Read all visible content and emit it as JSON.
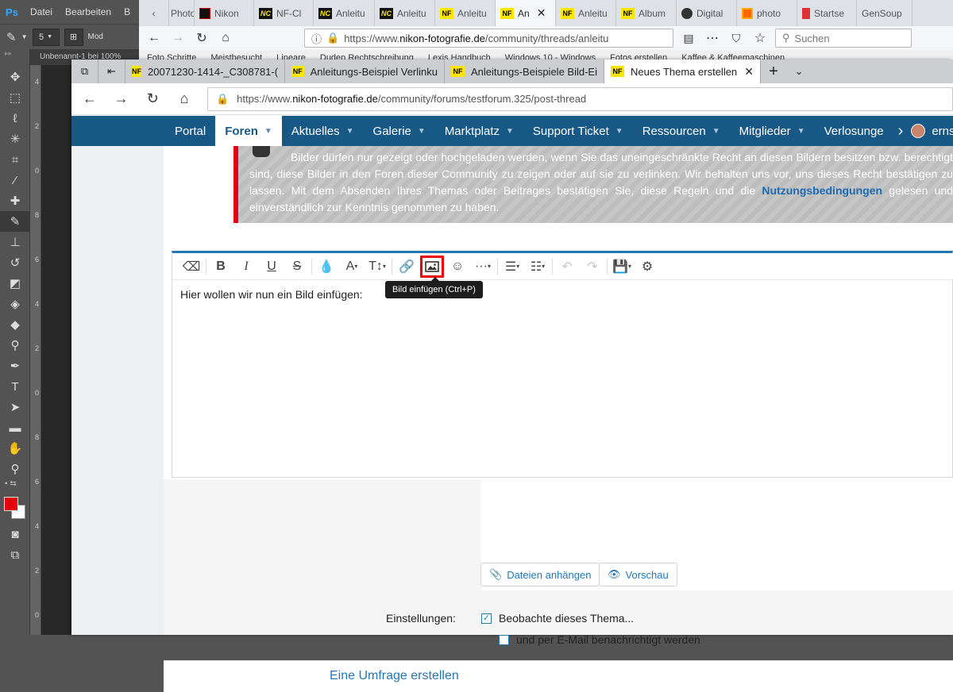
{
  "photoshop": {
    "logo": "Ps",
    "menu": [
      "Datei",
      "Bearbeiten",
      "B"
    ],
    "brush_size": "5",
    "mode_label": "Mod",
    "doc_tab": "Unbenannt-1 bei 100%",
    "ruler_numbers": [
      "4",
      "2",
      "0",
      "8",
      "6",
      "4",
      "2",
      "0",
      "8",
      "6",
      "4",
      "2",
      "0"
    ],
    "foreground_color": "#e3000f",
    "background_color": "#ffffff"
  },
  "back_browser": {
    "tabs": [
      {
        "label": "Photo",
        "favicon": "chevron-left"
      },
      {
        "label": "Nikon",
        "favicon": "nk"
      },
      {
        "label": "NF-Cl",
        "favicon": "nc"
      },
      {
        "label": "Anleitu",
        "favicon": "nc"
      },
      {
        "label": "Anleitu",
        "favicon": "nc"
      },
      {
        "label": "Anleitu",
        "favicon": "nf"
      },
      {
        "label": "An",
        "favicon": "nf"
      },
      {
        "label": "Anleitu",
        "favicon": "nf"
      },
      {
        "label": "Album",
        "favicon": "nf"
      },
      {
        "label": "Digital",
        "favicon": "round"
      },
      {
        "label": "photo",
        "favicon": "orange"
      },
      {
        "label": "Startse",
        "favicon": "red"
      },
      {
        "label": "GenSoup",
        "favicon": ""
      }
    ],
    "url_prefix": "https://www.",
    "url_domain": "nikon-fotografie.de",
    "url_path": "/community/threads/anleitu",
    "search_placeholder": "Suchen",
    "bookmarks": [
      "Foto Schritte",
      "Meistbesucht",
      "Lineare",
      "Duden Rechtschreibung",
      "Lexis Handbuch",
      "Windows 10 - Windows",
      "Fotos erstellen",
      "Kaffee & Kaffeemaschinen"
    ]
  },
  "front_browser": {
    "tabs": [
      {
        "label": "20071230-1414-_C308781-(",
        "favicon": "NF"
      },
      {
        "label": "Anleitungs-Beispiel Verlinku",
        "favicon": "NF"
      },
      {
        "label": "Anleitungs-Beispiele Bild-Ei",
        "favicon": "NF"
      },
      {
        "label": "Neues Thema erstellen",
        "favicon": "NF",
        "selected": true
      }
    ],
    "new_tab": "+",
    "url_prefix": "https://www.",
    "url_domain": "nikon-fotografie.de",
    "url_path": "/community/forums/testforum.325/post-thread"
  },
  "site_nav": {
    "items": [
      {
        "label": "Portal",
        "caret": false
      },
      {
        "label": "Foren",
        "caret": true,
        "selected": true
      },
      {
        "label": "Aktuelles",
        "caret": true
      },
      {
        "label": "Galerie",
        "caret": true
      },
      {
        "label": "Marktplatz",
        "caret": true
      },
      {
        "label": "Support Ticket",
        "caret": true
      },
      {
        "label": "Ressourcen",
        "caret": true
      },
      {
        "label": "Mitglieder",
        "caret": true
      },
      {
        "label": "Verlosunge",
        "caret": false
      }
    ],
    "user": "ernst.tes",
    "brand_color": "#185886"
  },
  "notice": {
    "text_1": "Bilder dürfen nur gezeigt oder hochgeladen werden, wenn Sie das uneingeschränkte Recht an diesen Bildern besitzen bzw. berechtigt sind, diese Bilder in den Foren dieser Community zu zeigen oder auf sie zu verlinken. Wir behalten uns vor, uns dieses Recht bestätigen zu lassen. Mit dem Absenden Ihres Themas oder Beitrages bestätigen Sie, diese Regeln und die ",
    "link": "Nutzungsbedingungen",
    "text_2": " gelesen und einverständlich zur Kenntnis genommen zu haben."
  },
  "editor": {
    "tooltip": "Bild einfügen (Ctrl+P)",
    "content": "Hier wollen wir nun ein Bild einfügen:",
    "highlight_color": "#e00000"
  },
  "form": {
    "attach_label": "Dateien anhängen",
    "preview_label": "Vorschau",
    "settings_label": "Einstellungen:",
    "watch_label": "Beobachte dieses Thema...",
    "watch_checked": true,
    "email_label": "und per E-Mail benachrichtigt werden",
    "email_checked": false,
    "poll_link": "Eine Umfrage erstellen"
  }
}
